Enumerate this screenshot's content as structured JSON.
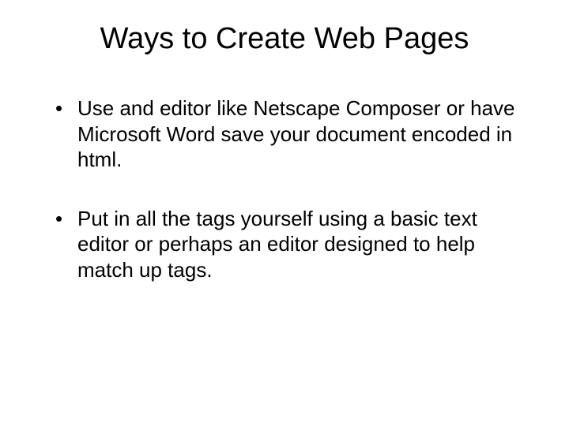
{
  "slide": {
    "title": "Ways to Create Web Pages",
    "bullets": [
      "Use and editor like Netscape Composer or have Microsoft Word save your document encoded in html.",
      "Put in all the tags yourself using a basic text editor or perhaps an editor designed to help match up tags."
    ]
  }
}
